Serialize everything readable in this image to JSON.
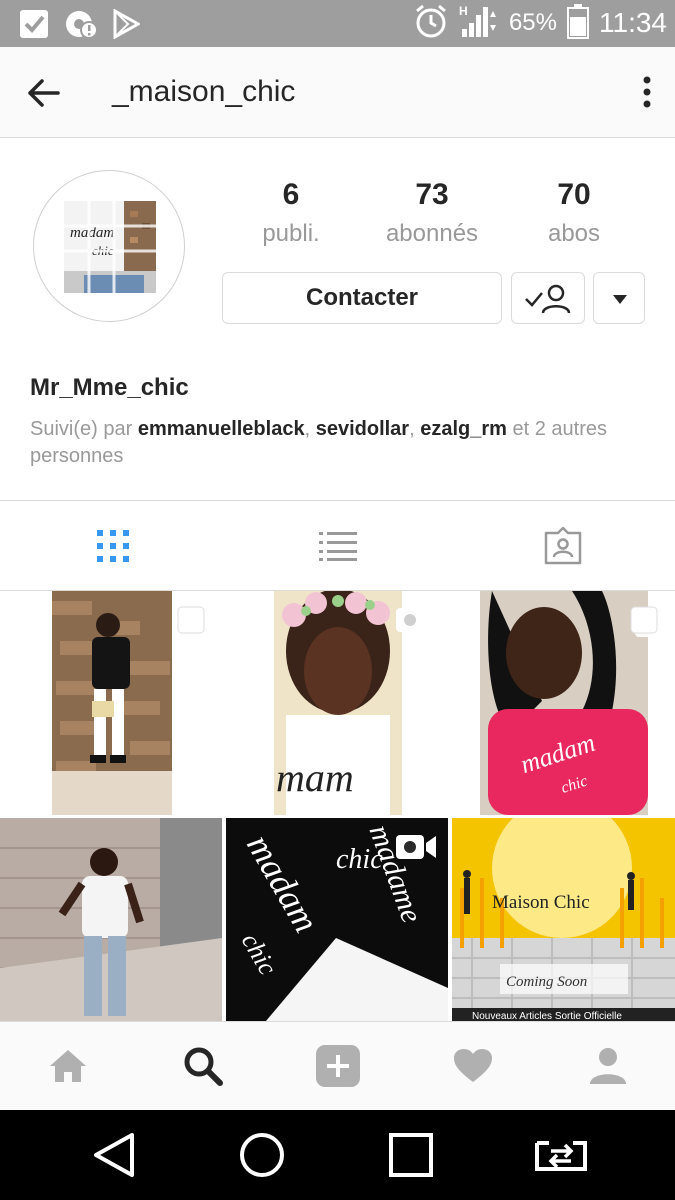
{
  "status_bar": {
    "battery": "65%",
    "time": "11:34",
    "network": "H",
    "icons": [
      "check-box-icon",
      "chrome-alert-icon",
      "play-store-icon",
      "alarm-icon",
      "signal-icon",
      "battery-icon"
    ]
  },
  "header": {
    "title": "_maison_chic",
    "back_icon": "back-arrow-icon",
    "more_icon": "more-vertical-icon"
  },
  "profile": {
    "stats": [
      {
        "value": "6",
        "label": "publi."
      },
      {
        "value": "73",
        "label": "abonnés"
      },
      {
        "value": "70",
        "label": "abos"
      }
    ],
    "contact_label": "Contacter",
    "name": "Mr_Mme_chic",
    "followed_by": {
      "prefix": "Suivi(e) par",
      "users": [
        "emmanuelleblack",
        "sevidollar",
        "ezalg_rm"
      ],
      "suffix": "et 2 autres personnes"
    },
    "avatar_text": [
      "madam",
      "chic"
    ]
  },
  "tabs": [
    {
      "name": "grid-view",
      "icon": "grid-icon",
      "active": true
    },
    {
      "name": "list-view",
      "icon": "list-icon",
      "active": false
    },
    {
      "name": "tagged",
      "icon": "tagged-person-icon",
      "active": false
    }
  ],
  "posts": [
    {
      "type": "multi",
      "badge": "multiple-posts-icon"
    },
    {
      "type": "video",
      "badge": "video-camera-icon"
    },
    {
      "type": "multi",
      "badge": "multiple-posts-icon",
      "shirt_text": "madame chic"
    },
    {
      "type": "photo"
    },
    {
      "type": "video",
      "badge": "video-camera-icon",
      "shirt_text": [
        "madame",
        "chic",
        "madam",
        "chic"
      ]
    },
    {
      "type": "photo",
      "poster_title": "Maison Chic",
      "poster_subtitle": "Coming Soon",
      "poster_footer": "Nouveaux Articles Sortie Officielle"
    }
  ],
  "bottom_nav": [
    {
      "name": "home",
      "icon": "home-icon"
    },
    {
      "name": "search",
      "icon": "search-icon",
      "active": true
    },
    {
      "name": "add",
      "icon": "add-post-icon"
    },
    {
      "name": "activity",
      "icon": "heart-icon"
    },
    {
      "name": "profile",
      "icon": "profile-icon"
    }
  ],
  "android_nav": [
    "back-triangle-icon",
    "home-circle-icon",
    "recents-square-icon",
    "switch-screen-icon"
  ],
  "colors": {
    "accent_blue": "#3897f0",
    "text_dark": "#262626",
    "text_gray": "#999999",
    "pink_shirt": "#e8285e",
    "poster_yellow": "#f5c400"
  }
}
